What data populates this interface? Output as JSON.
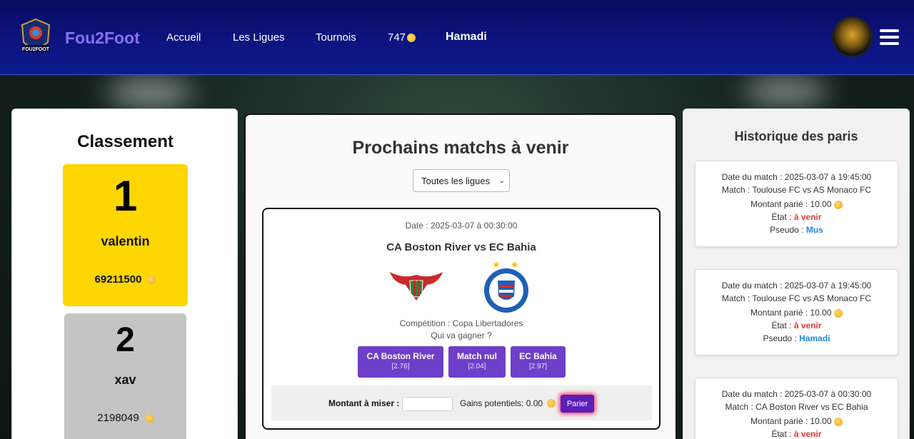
{
  "header": {
    "brand": "Fou2Foot",
    "logo_text": "FOU2FOOT",
    "nav": [
      "Accueil",
      "Les Ligues",
      "Tournois"
    ],
    "coins": "747",
    "username": "Hamadi"
  },
  "ranking": {
    "title": "Classement",
    "entries": [
      {
        "rank": "1",
        "name": "valentin",
        "score": "69211500",
        "color": "#ffd600"
      },
      {
        "rank": "2",
        "name": "xav",
        "score": "2198049",
        "color": "#c4c4c4"
      }
    ]
  },
  "matches": {
    "title": "Prochains matchs à venir",
    "league_filter": "Toutes les ligues",
    "card": {
      "date": "Date : 2025-03-07 à 00:30:00",
      "title": "CA Boston River vs EC Bahia",
      "competition": "Compétition : Copa Libertadores",
      "question": "Qui va gagner ?",
      "options": [
        {
          "label": "CA Boston River",
          "odds": "[2.76]"
        },
        {
          "label": "Match nul",
          "odds": "[2.04]"
        },
        {
          "label": "EC Bahia",
          "odds": "[2.97]"
        }
      ],
      "bet_label": "Montant à miser :",
      "gains": "Gains potentiels: 0.00",
      "submit": "Parier"
    }
  },
  "history": {
    "title": "Historique des paris",
    "items": [
      {
        "date": "Date du match : 2025-03-07 à 19:45:00",
        "match": "Match : Toulouse FC vs AS Monaco FC",
        "amount": "Montant parié : 10.00",
        "state_label": "État : ",
        "state": "à venir",
        "pseudo_label": "Pseudo : ",
        "pseudo": "Mus"
      },
      {
        "date": "Date du match : 2025-03-07 à 19:45:00",
        "match": "Match : Toulouse FC vs AS Monaco FC",
        "amount": "Montant parié : 10.00",
        "state_label": "État : ",
        "state": "à venir",
        "pseudo_label": "Pseudo : ",
        "pseudo": "Hamadi"
      },
      {
        "date": "Date du match : 2025-03-07 à 00:30:00",
        "match": "Match : CA Boston River vs EC Bahia",
        "amount": "Montant parié : 10.00",
        "state_label": "État : ",
        "state": "à venir"
      }
    ]
  },
  "colors": {
    "header_bg": "#0c1480",
    "brand": "#8a6ff0",
    "bet_button": "#6e3fc9",
    "state": "#e53935",
    "pseudo": "#1e88e5"
  }
}
